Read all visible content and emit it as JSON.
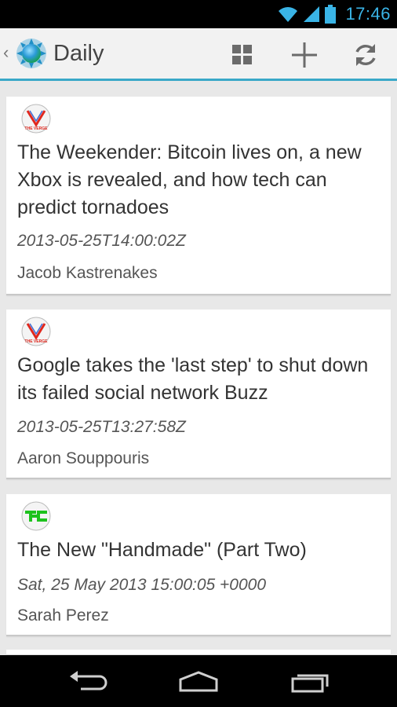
{
  "status_bar": {
    "time": "17:46"
  },
  "action_bar": {
    "title": "Daily",
    "actions": [
      {
        "name": "grid-view",
        "icon": "grid-icon"
      },
      {
        "name": "add",
        "icon": "plus-icon"
      },
      {
        "name": "refresh",
        "icon": "refresh-icon"
      }
    ]
  },
  "articles": [
    {
      "source": "The Verge",
      "logo_text": "THE VERGE",
      "headline": "The Weekender: Bitcoin lives on, a new Xbox is revealed, and how tech can predict tornadoes",
      "date": "2013-05-25T14:00:02Z",
      "author": "Jacob Kastrenakes"
    },
    {
      "source": "The Verge",
      "logo_text": "THE VERGE",
      "headline": "Google takes the 'last step' to shut down its failed social network Buzz",
      "date": "2013-05-25T13:27:58Z",
      "author": "Aaron Souppouris"
    },
    {
      "source": "TechCrunch",
      "logo_text": "TC",
      "headline": "The New \"Handmade\" (Part Two)",
      "date": "Sat, 25 May 2013 15:00:05 +0000",
      "author": "Sarah Perez"
    }
  ],
  "nav_bar": {
    "buttons": [
      {
        "name": "back",
        "icon": "back-icon"
      },
      {
        "name": "home",
        "icon": "home-icon"
      },
      {
        "name": "recents",
        "icon": "recents-icon"
      }
    ]
  },
  "colors": {
    "accent": "#3aa8c8",
    "status_text": "#3ab4e6",
    "verge_red": "#e0281e",
    "tc_green": "#1ec21e"
  }
}
